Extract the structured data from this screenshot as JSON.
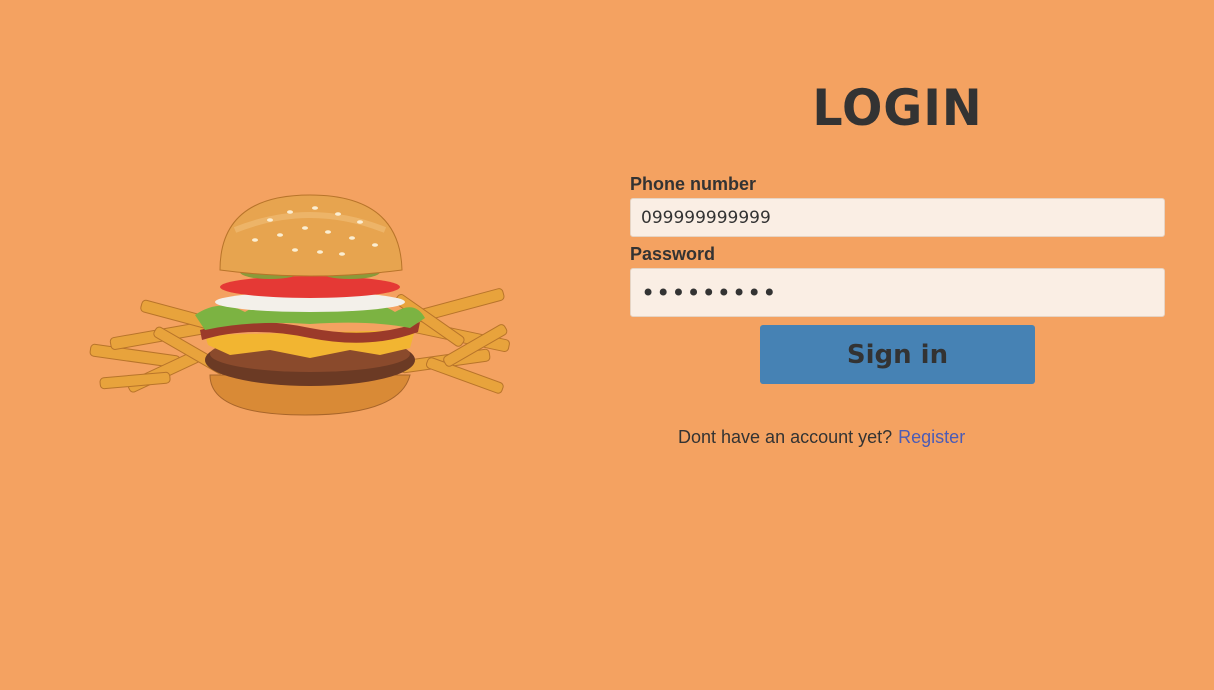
{
  "login": {
    "title": "LOGIN",
    "phone_label": "Phone number",
    "phone_value": "099999999999",
    "password_label": "Password",
    "password_value": "123456789",
    "signin_label": "Sign in",
    "register_prompt": "Dont have an account yet?",
    "register_link": "Register"
  },
  "hero": {
    "image": "burger-with-fries"
  },
  "colors": {
    "background": "#f4a261",
    "input_background": "#faeee4",
    "button": "#4682b4",
    "text": "#333333",
    "link": "#4b5bb5"
  }
}
